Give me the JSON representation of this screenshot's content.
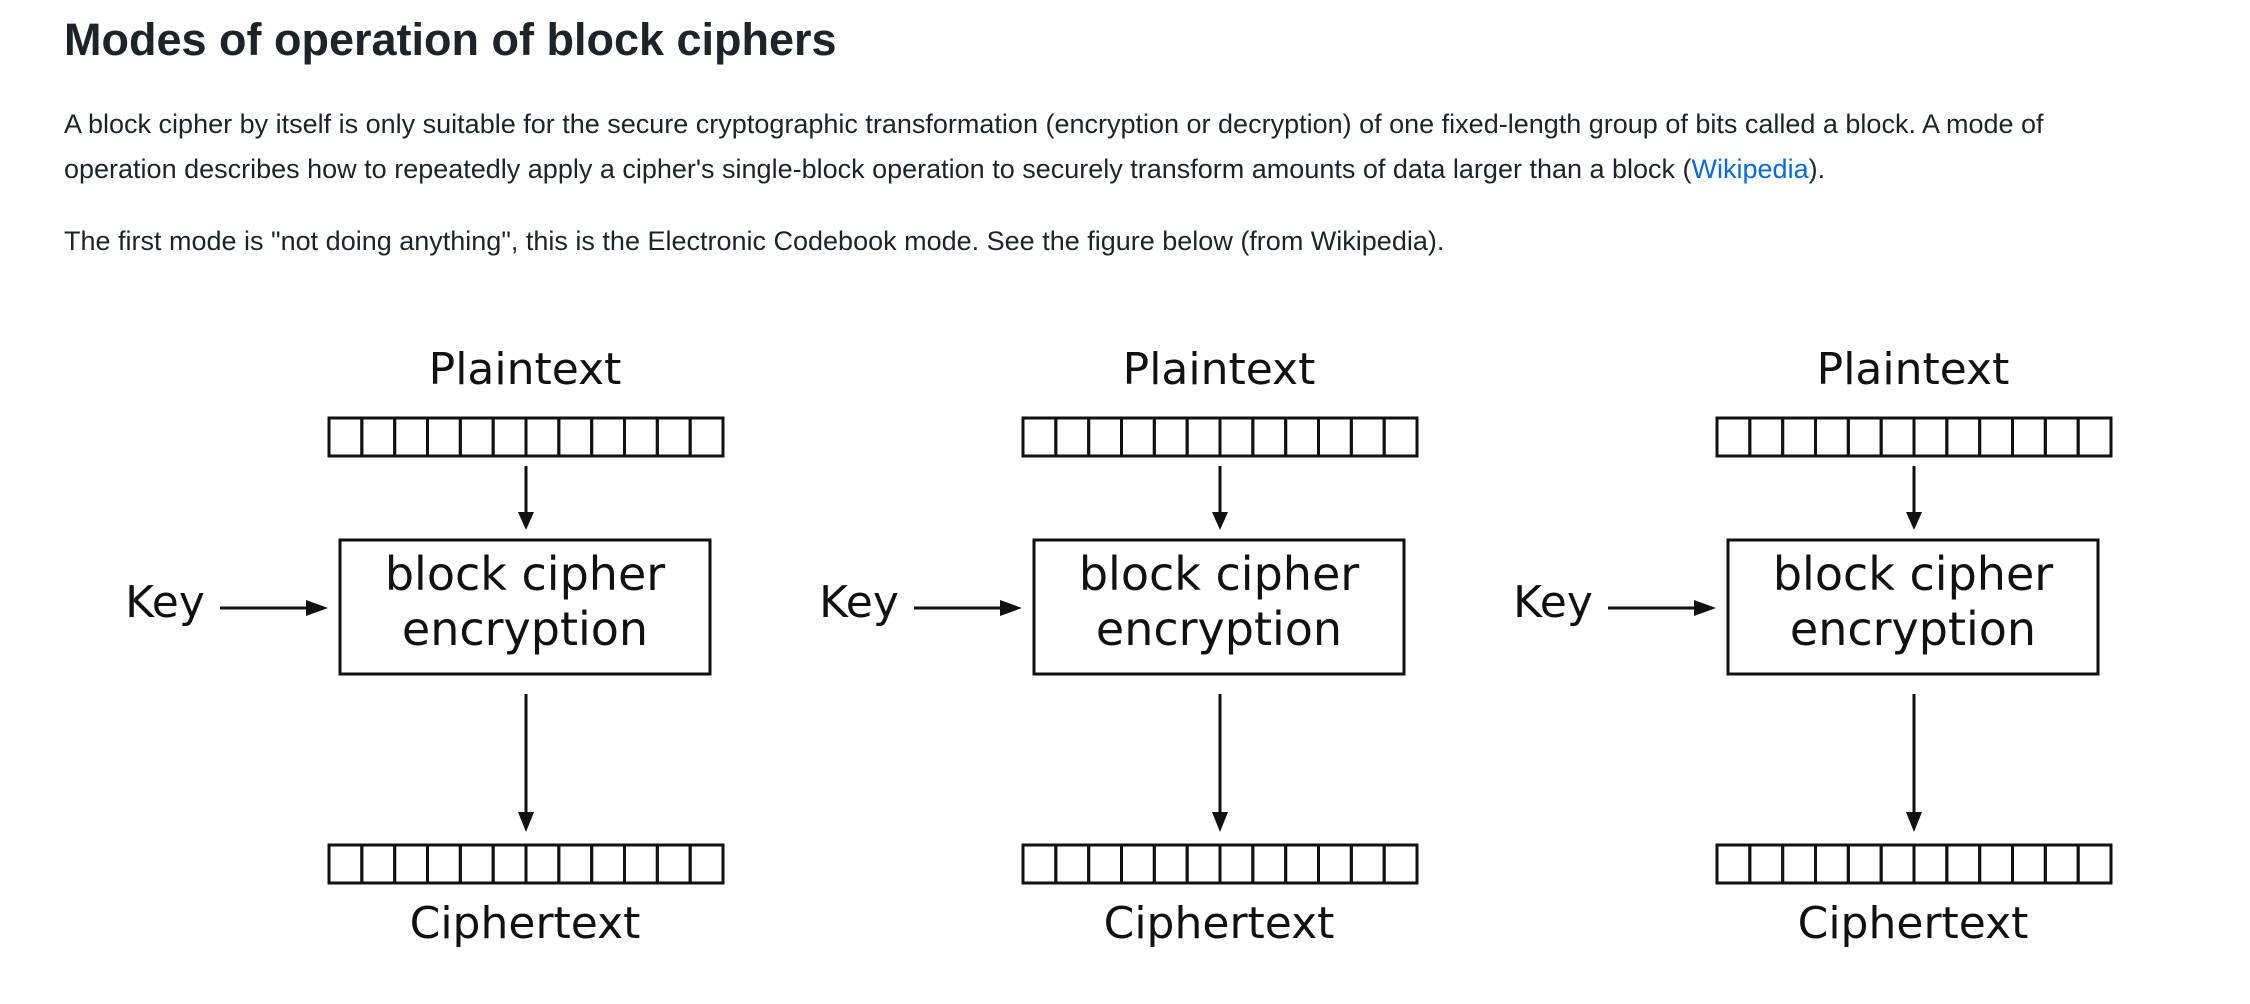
{
  "heading": "Modes of operation of block ciphers",
  "paragraph1": {
    "line1": "A block cipher by itself is only suitable for the secure cryptographic transformation (encryption or decryption) of one fixed-length group of bits called a block. A mode of",
    "line2_before_link": "operation describes how to repeatedly apply a cipher's single-block operation to securely transform amounts of data larger than a block (",
    "link_text": "Wikipedia",
    "line2_after_link": ")."
  },
  "paragraph2": "The first mode is \"not doing anything\", this is the Electronic Codebook mode. See the figure below (from Wikipedia).",
  "figure": {
    "blocks": [
      {
        "plaintext_label": "Plaintext",
        "key_label": "Key",
        "cipher_line1": "block cipher",
        "cipher_line2": "encryption",
        "ciphertext_label": "Ciphertext"
      },
      {
        "plaintext_label": "Plaintext",
        "key_label": "Key",
        "cipher_line1": "block cipher",
        "cipher_line2": "encryption",
        "ciphertext_label": "Ciphertext"
      },
      {
        "plaintext_label": "Plaintext",
        "key_label": "Key",
        "cipher_line1": "block cipher",
        "cipher_line2": "encryption",
        "ciphertext_label": "Ciphertext"
      }
    ],
    "cells_per_bar": 12
  },
  "colors": {
    "text": "#1f2328",
    "link": "#0969da",
    "diagram": "#111111"
  }
}
